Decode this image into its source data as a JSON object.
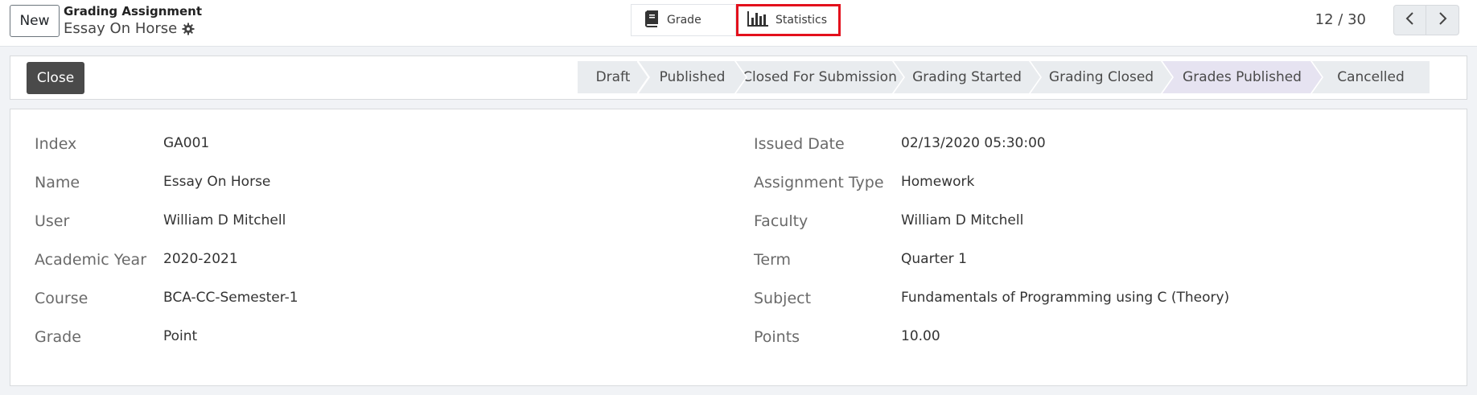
{
  "header": {
    "new_label": "New",
    "breadcrumb_parent": "Grading Assignment",
    "record_title": "Essay On Horse",
    "smart_buttons": [
      {
        "label": "Grade",
        "icon": "book-icon"
      },
      {
        "label": "Statistics",
        "icon": "bar-chart-icon"
      }
    ],
    "pager_text": "12 / 30"
  },
  "statusbar": {
    "close_label": "Close",
    "stages": [
      "Draft",
      "Published",
      "Closed For Submission",
      "Grading Started",
      "Grading Closed",
      "Grades Published",
      "Cancelled"
    ],
    "active_stage": "Grades Published"
  },
  "form": {
    "left": [
      {
        "label": "Index",
        "value": "GA001"
      },
      {
        "label": "Name",
        "value": "Essay On Horse"
      },
      {
        "label": "User",
        "value": "William D Mitchell"
      },
      {
        "label": "Academic Year",
        "value": "2020-2021"
      },
      {
        "label": "Course",
        "value": "BCA-CC-Semester-1"
      },
      {
        "label": "Grade",
        "value": "Point"
      }
    ],
    "right": [
      {
        "label": "Issued Date",
        "value": "02/13/2020 05:30:00"
      },
      {
        "label": "Assignment Type",
        "value": "Homework"
      },
      {
        "label": "Faculty",
        "value": "William D Mitchell"
      },
      {
        "label": "Term",
        "value": "Quarter 1"
      },
      {
        "label": "Subject",
        "value": "Fundamentals of Programming using C (Theory)"
      },
      {
        "label": "Points",
        "value": "10.00"
      }
    ]
  },
  "colors": {
    "highlight": "#e3101c",
    "active_stage": "#e6e3f1",
    "close_button": "#4a4a4a"
  }
}
